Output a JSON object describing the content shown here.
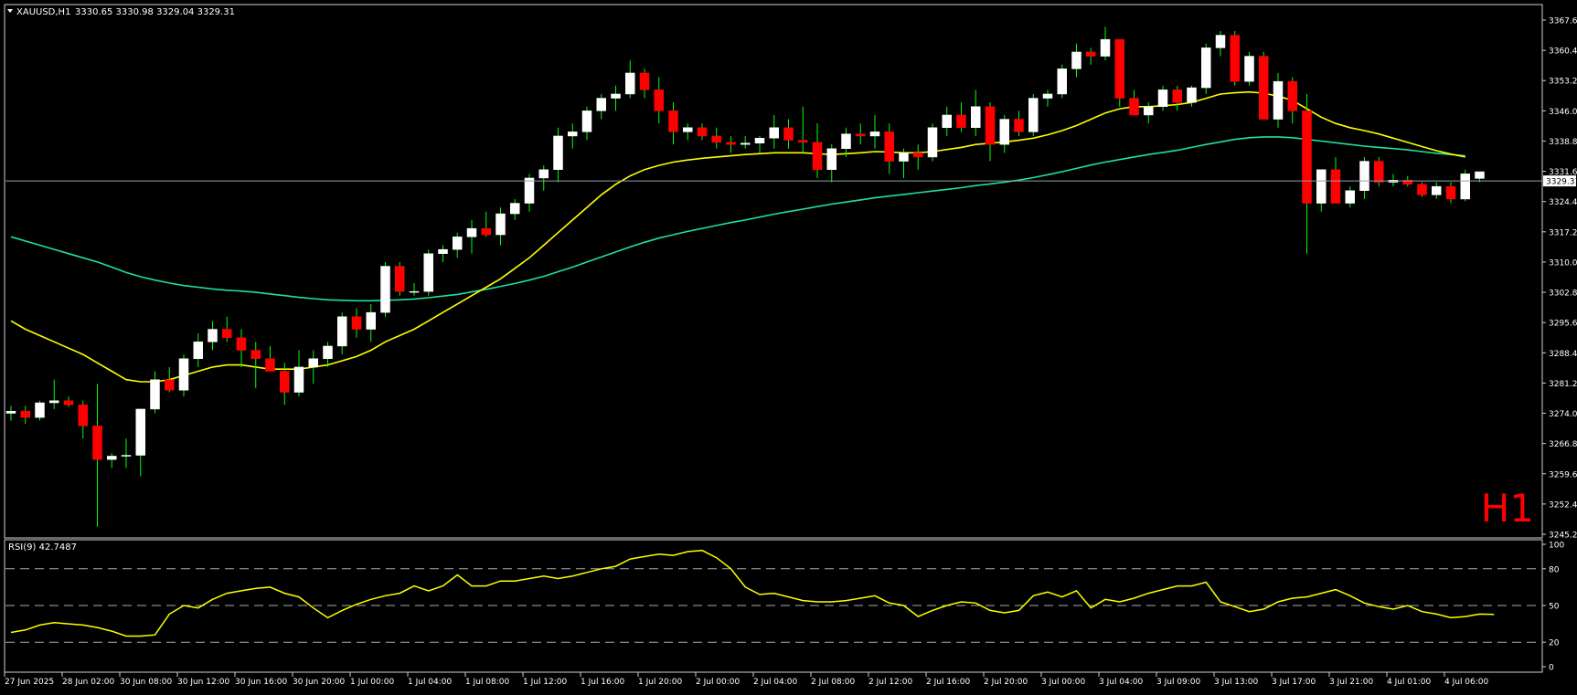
{
  "header": {
    "symbol": "XAUUSD,H1",
    "ohlc": "3330.65 3330.98 3329.04 3329.31"
  },
  "timeframe_label": "H1",
  "price_panel": {
    "ymin": 3245.2,
    "ymax": 3367.6,
    "ticks": [
      "3367.60",
      "3360.40",
      "3353.20",
      "3346.00",
      "3338.80",
      "3331.60",
      "3324.40",
      "3317.20",
      "3310.00",
      "3302.80",
      "3295.60",
      "3288.40",
      "3281.20",
      "3274.00",
      "3266.80",
      "3259.60",
      "3252.40",
      "3245.20"
    ],
    "current_price": 3329.31,
    "current_price_label": "3329.31"
  },
  "rsi_panel": {
    "label": "RSI(9) 42.7487",
    "ymin": 0,
    "ymax": 100,
    "ticks": [
      "100",
      "80",
      "50",
      "20",
      "0"
    ],
    "levels": [
      80,
      50,
      20
    ]
  },
  "x_axis": {
    "labels": [
      {
        "text": "27 Jun 2025",
        "index": 0
      },
      {
        "text": "28 Jun 02:00",
        "index": 4
      },
      {
        "text": "30 Jun 08:00",
        "index": 8
      },
      {
        "text": "30 Jun 12:00",
        "index": 12
      },
      {
        "text": "30 Jun 16:00",
        "index": 16
      },
      {
        "text": "30 Jun 20:00",
        "index": 20
      },
      {
        "text": "1 Jul 00:00",
        "index": 24
      },
      {
        "text": "1 Jul 04:00",
        "index": 28
      },
      {
        "text": "1 Jul 08:00",
        "index": 32
      },
      {
        "text": "1 Jul 12:00",
        "index": 36
      },
      {
        "text": "1 Jul 16:00",
        "index": 40
      },
      {
        "text": "1 Jul 20:00",
        "index": 44
      },
      {
        "text": "2 Jul 00:00",
        "index": 48
      },
      {
        "text": "2 Jul 04:00",
        "index": 52
      },
      {
        "text": "2 Jul 08:00",
        "index": 56
      },
      {
        "text": "2 Jul 12:00",
        "index": 60
      },
      {
        "text": "2 Jul 16:00",
        "index": 64
      },
      {
        "text": "2 Jul 20:00",
        "index": 68
      },
      {
        "text": "3 Jul 00:00",
        "index": 72
      },
      {
        "text": "3 Jul 04:00",
        "index": 76
      },
      {
        "text": "3 Jul 09:00",
        "index": 80
      },
      {
        "text": "3 Jul 13:00",
        "index": 84
      },
      {
        "text": "3 Jul 17:00",
        "index": 88
      },
      {
        "text": "3 Jul 21:00",
        "index": 92
      },
      {
        "text": "4 Jul 01:00",
        "index": 96
      },
      {
        "text": "4 Jul 06:00",
        "index": 100
      }
    ]
  },
  "colors": {
    "background": "#000000",
    "bull_candle": "#ffffff",
    "bear_candle": "#ff0000",
    "wick": "#00ff00",
    "ma_fast": "#ffff00",
    "ma_slow": "#20e0a0",
    "rsi_line": "#ffff00",
    "grid_text": "#ffffff",
    "price_line": "#8fa0b8",
    "timeframe_label": "#ff0000"
  },
  "chart_data": {
    "type": "candlestick",
    "series": [
      {
        "name": "XAUUSD",
        "ohlc": [
          [
            3274.0,
            3275.8,
            3272.2,
            3274.5
          ],
          [
            3274.5,
            3275.8,
            3271.5,
            3273.0
          ],
          [
            3273.0,
            3277.0,
            3272.3,
            3276.5
          ],
          [
            3276.5,
            3282.0,
            3275.0,
            3277.0
          ],
          [
            3277.0,
            3278.0,
            3275.5,
            3276.0
          ],
          [
            3276.0,
            3277.0,
            3268.0,
            3271.0
          ],
          [
            3271.0,
            3281.0,
            3247.0,
            3263.0
          ],
          [
            3263.0,
            3264.5,
            3261.0,
            3263.8
          ],
          [
            3263.8,
            3268.0,
            3261.0,
            3264.0
          ],
          [
            3264.0,
            3275.0,
            3259.0,
            3275.0
          ],
          [
            3275.0,
            3284.0,
            3274.0,
            3282.0
          ],
          [
            3282.0,
            3285.0,
            3279.0,
            3279.5
          ],
          [
            3279.5,
            3288.0,
            3278.0,
            3287.0
          ],
          [
            3287.0,
            3293.0,
            3285.0,
            3291.0
          ],
          [
            3291.0,
            3296.0,
            3289.0,
            3294.0
          ],
          [
            3294.0,
            3297.0,
            3291.0,
            3292.0
          ],
          [
            3292.0,
            3294.0,
            3285.0,
            3289.0
          ],
          [
            3289.0,
            3291.0,
            3280.0,
            3287.0
          ],
          [
            3287.0,
            3290.0,
            3285.0,
            3284.0
          ],
          [
            3284.0,
            3286.0,
            3276.0,
            3279.0
          ],
          [
            3279.0,
            3289.0,
            3278.0,
            3285.0
          ],
          [
            3285.0,
            3289.0,
            3281.0,
            3287.0
          ],
          [
            3287.0,
            3291.0,
            3285.0,
            3290.0
          ],
          [
            3290.0,
            3298.0,
            3288.0,
            3297.0
          ],
          [
            3297.0,
            3299.0,
            3292.0,
            3294.0
          ],
          [
            3294.0,
            3300.0,
            3291.0,
            3298.0
          ],
          [
            3298.0,
            3310.0,
            3297.0,
            3309.0
          ],
          [
            3309.0,
            3310.0,
            3302.0,
            3303.0
          ],
          [
            3303.0,
            3305.0,
            3302.0,
            3303.0
          ],
          [
            3303.0,
            3313.0,
            3302.0,
            3312.0
          ],
          [
            3312.0,
            3314.0,
            3310.0,
            3313.0
          ],
          [
            3313.0,
            3317.0,
            3311.0,
            3316.0
          ],
          [
            3316.0,
            3320.0,
            3312.0,
            3318.0
          ],
          [
            3318.0,
            3322.0,
            3316.0,
            3316.5
          ],
          [
            3316.5,
            3323.0,
            3314.0,
            3321.5
          ],
          [
            3321.5,
            3325.0,
            3320.0,
            3324.0
          ],
          [
            3324.0,
            3331.0,
            3322.0,
            3330.0
          ],
          [
            3330.0,
            3333.0,
            3327.0,
            3332.0
          ],
          [
            3332.0,
            3342.0,
            3329.0,
            3340.0
          ],
          [
            3340.0,
            3343.0,
            3337.0,
            3341.0
          ],
          [
            3341.0,
            3347.0,
            3339.0,
            3346.0
          ],
          [
            3346.0,
            3350.0,
            3344.0,
            3349.0
          ],
          [
            3349.0,
            3352.0,
            3346.0,
            3350.0
          ],
          [
            3350.0,
            3358.0,
            3349.0,
            3355.0
          ],
          [
            3355.0,
            3356.0,
            3349.0,
            3351.0
          ],
          [
            3351.0,
            3354.0,
            3343.0,
            3346.0
          ],
          [
            3346.0,
            3348.0,
            3338.0,
            3341.0
          ],
          [
            3341.0,
            3343.0,
            3339.0,
            3342.0
          ],
          [
            3342.0,
            3343.0,
            3339.0,
            3340.0
          ],
          [
            3340.0,
            3342.0,
            3337.0,
            3338.5
          ],
          [
            3338.5,
            3340.0,
            3336.0,
            3338.0
          ],
          [
            3338.0,
            3340.0,
            3337.0,
            3338.3
          ],
          [
            3338.3,
            3340.0,
            3336.0,
            3339.5
          ],
          [
            3339.5,
            3345.0,
            3337.0,
            3342.0
          ],
          [
            3342.0,
            3344.0,
            3337.0,
            3339.0
          ],
          [
            3339.0,
            3347.0,
            3336.0,
            3338.5
          ],
          [
            3338.5,
            3343.0,
            3330.0,
            3332.0
          ],
          [
            3332.0,
            3338.0,
            3329.0,
            3337.0
          ],
          [
            3337.0,
            3342.0,
            3335.0,
            3340.5
          ],
          [
            3340.5,
            3343.0,
            3338.0,
            3340.0
          ],
          [
            3340.0,
            3345.0,
            3337.0,
            3341.0
          ],
          [
            3341.0,
            3343.0,
            3331.0,
            3334.0
          ],
          [
            3334.0,
            3337.0,
            3330.0,
            3336.0
          ],
          [
            3336.0,
            3338.0,
            3332.0,
            3335.0
          ],
          [
            3335.0,
            3343.0,
            3334.0,
            3342.0
          ],
          [
            3342.0,
            3347.0,
            3340.0,
            3345.0
          ],
          [
            3345.0,
            3348.0,
            3341.0,
            3342.0
          ],
          [
            3342.0,
            3351.0,
            3340.0,
            3347.0
          ],
          [
            3347.0,
            3348.0,
            3334.0,
            3338.0
          ],
          [
            3338.0,
            3345.0,
            3336.0,
            3344.0
          ],
          [
            3344.0,
            3346.0,
            3340.0,
            3341.0
          ],
          [
            3341.0,
            3350.0,
            3340.0,
            3349.0
          ],
          [
            3349.0,
            3351.0,
            3347.0,
            3350.0
          ],
          [
            3350.0,
            3357.0,
            3349.0,
            3356.0
          ],
          [
            3356.0,
            3362.0,
            3354.0,
            3360.0
          ],
          [
            3360.0,
            3361.0,
            3357.0,
            3359.0
          ],
          [
            3359.0,
            3366.0,
            3358.0,
            3363.0
          ],
          [
            3363.0,
            3363.0,
            3347.0,
            3349.0
          ],
          [
            3349.0,
            3351.0,
            3345.0,
            3345.0
          ],
          [
            3345.0,
            3348.0,
            3343.0,
            3347.0
          ],
          [
            3347.0,
            3352.0,
            3346.0,
            3351.0
          ],
          [
            3351.0,
            3352.0,
            3346.0,
            3348.0
          ],
          [
            3348.0,
            3352.0,
            3347.0,
            3351.5
          ],
          [
            3351.5,
            3362.0,
            3350.0,
            3361.0
          ],
          [
            3361.0,
            3365.0,
            3359.0,
            3364.0
          ],
          [
            3364.0,
            3365.0,
            3352.0,
            3353.0
          ],
          [
            3353.0,
            3360.0,
            3352.0,
            3359.0
          ],
          [
            3359.0,
            3360.0,
            3351.0,
            3344.0
          ],
          [
            3344.0,
            3355.0,
            3342.0,
            3353.0
          ],
          [
            3353.0,
            3354.0,
            3343.0,
            3346.0
          ],
          [
            3346.0,
            3350.0,
            3312.0,
            3324.0
          ],
          [
            3324.0,
            3332.0,
            3322.0,
            3332.0
          ],
          [
            3332.0,
            3335.0,
            3325.0,
            3324.0
          ],
          [
            3324.0,
            3328.0,
            3323.0,
            3327.0
          ],
          [
            3327.0,
            3335.0,
            3325.0,
            3334.0
          ],
          [
            3334.0,
            3335.0,
            3328.0,
            3329.0
          ],
          [
            3329.0,
            3331.0,
            3328.0,
            3329.5
          ],
          [
            3329.5,
            3330.5,
            3328.0,
            3328.5
          ],
          [
            3328.5,
            3329.0,
            3325.5,
            3326.0
          ],
          [
            3326.0,
            3329.0,
            3325.0,
            3328.0
          ],
          [
            3328.0,
            3329.0,
            3324.0,
            3325.0
          ],
          [
            3325.0,
            3332.0,
            3324.5,
            3331.0
          ],
          [
            3329.9,
            3330.98,
            3329.04,
            3331.5
          ]
        ]
      },
      {
        "name": "MA fast",
        "values": [
          3296.0,
          3294.0,
          3292.5,
          3291.0,
          3289.5,
          3288.0,
          3286.0,
          3284.0,
          3282.0,
          3281.5,
          3281.5,
          3282.0,
          3283.0,
          3284.0,
          3285.0,
          3285.5,
          3285.5,
          3285.0,
          3284.5,
          3284.5,
          3284.5,
          3285.0,
          3285.5,
          3286.5,
          3287.5,
          3289.0,
          3291.0,
          3292.5,
          3294.0,
          3296.0,
          3298.0,
          3300.0,
          3302.0,
          3304.0,
          3306.0,
          3308.5,
          3311.0,
          3314.0,
          3317.0,
          3320.0,
          3323.0,
          3326.0,
          3328.5,
          3330.5,
          3332.0,
          3333.0,
          3333.8,
          3334.3,
          3334.7,
          3335.0,
          3335.3,
          3335.6,
          3335.8,
          3336.0,
          3336.0,
          3336.0,
          3335.8,
          3335.6,
          3335.8,
          3336.0,
          3336.3,
          3336.2,
          3336.0,
          3336.0,
          3336.3,
          3336.8,
          3337.3,
          3338.0,
          3338.3,
          3338.6,
          3339.0,
          3339.5,
          3340.3,
          3341.3,
          3342.5,
          3344.0,
          3345.5,
          3346.5,
          3347.0,
          3347.0,
          3347.2,
          3347.5,
          3348.0,
          3349.0,
          3350.0,
          3350.3,
          3350.5,
          3350.2,
          3349.5,
          3348.5,
          3346.5,
          3344.5,
          3343.0,
          3342.0,
          3341.3,
          3340.5,
          3339.5,
          3338.5,
          3337.5,
          3336.5,
          3335.7,
          3335.0
        ]
      },
      {
        "name": "MA slow",
        "values": [
          3316.0,
          3315.0,
          3314.0,
          3313.0,
          3312.0,
          3311.0,
          3310.0,
          3308.8,
          3307.5,
          3306.5,
          3305.7,
          3305.0,
          3304.4,
          3304.0,
          3303.6,
          3303.3,
          3303.1,
          3302.8,
          3302.4,
          3302.0,
          3301.6,
          3301.3,
          3301.0,
          3300.9,
          3300.8,
          3300.8,
          3300.9,
          3301.0,
          3301.2,
          3301.5,
          3301.9,
          3302.3,
          3302.9,
          3303.5,
          3304.2,
          3304.9,
          3305.7,
          3306.6,
          3307.7,
          3308.8,
          3310.0,
          3311.2,
          3312.4,
          3313.6,
          3314.7,
          3315.7,
          3316.5,
          3317.3,
          3318.0,
          3318.7,
          3319.4,
          3320.0,
          3320.7,
          3321.4,
          3322.0,
          3322.6,
          3323.2,
          3323.8,
          3324.3,
          3324.8,
          3325.3,
          3325.7,
          3326.1,
          3326.5,
          3326.9,
          3327.3,
          3327.7,
          3328.2,
          3328.6,
          3329.0,
          3329.5,
          3330.1,
          3330.8,
          3331.5,
          3332.3,
          3333.1,
          3333.8,
          3334.4,
          3335.0,
          3335.6,
          3336.1,
          3336.6,
          3337.3,
          3338.0,
          3338.6,
          3339.2,
          3339.6,
          3339.8,
          3339.8,
          3339.6,
          3339.2,
          3338.8,
          3338.4,
          3338.0,
          3337.6,
          3337.3,
          3337.0,
          3336.7,
          3336.3,
          3335.9,
          3335.6,
          3335.3
        ]
      },
      {
        "name": "RSI(9)",
        "values": [
          28,
          30,
          34,
          36,
          35,
          34,
          32,
          29,
          25,
          25,
          26,
          43,
          50,
          48,
          55,
          60,
          62,
          64,
          65,
          60,
          57,
          48,
          40,
          46,
          51,
          55,
          58,
          60,
          66,
          62,
          66,
          75,
          66,
          66,
          70,
          70,
          72,
          74,
          72,
          74,
          77,
          80,
          82,
          88,
          90,
          92,
          91,
          94,
          95,
          89,
          80,
          65,
          59,
          60,
          57,
          54,
          53,
          53,
          54,
          56,
          58,
          52,
          50,
          41,
          46,
          50,
          53,
          52,
          46,
          44,
          46,
          58,
          61,
          57,
          62,
          48,
          55,
          53,
          56,
          60,
          63,
          66,
          66,
          69,
          53,
          49,
          45,
          47,
          53,
          56,
          57,
          60,
          63,
          58,
          52,
          49,
          47,
          50,
          45,
          43,
          40,
          41,
          43,
          42.7
        ]
      }
    ],
    "ylim": [
      3245.2,
      3367.6
    ]
  }
}
